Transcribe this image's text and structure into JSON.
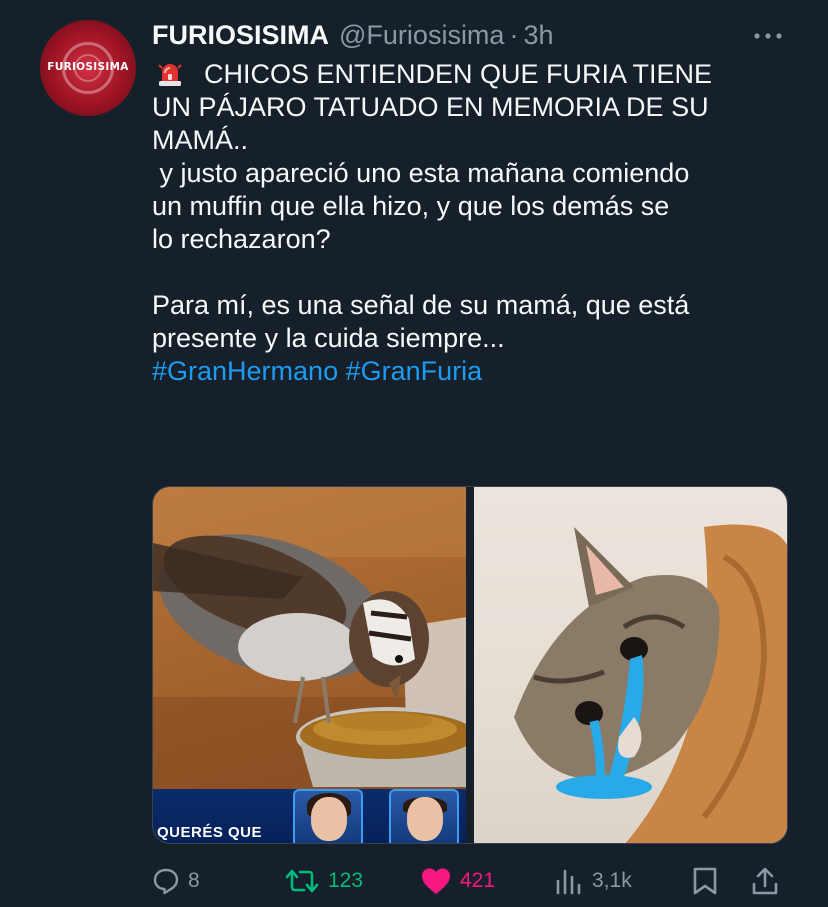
{
  "tweet": {
    "avatar_text": "FURIOSISIMA",
    "display_name": "FURIOSISIMA",
    "handle": "@Furiosisima",
    "separator": "·",
    "time": "3h",
    "text_lines": [
      "CHICOS ENTIENDEN QUE FURIA TIENE",
      "UN PÁJARO TATUADO EN MEMORIA DE SU",
      "MAMÁ..",
      " y justo apareció uno esta mañana comiendo",
      "un muffin que ella hizo, y que los demás se",
      "lo rechazaron?",
      "",
      "Para mí, es una señal de su mamá, que está",
      "presente y la cuida siempre..."
    ],
    "hashtags": "#GranHermano #GranFuria",
    "media": {
      "tv_caption": "QUERÉS QUE"
    },
    "actions": {
      "reply_count": "8",
      "retweet_count": "123",
      "like_count": "421",
      "views_count": "3,1k"
    }
  },
  "icons": {
    "siren": "police-car-light-icon",
    "more": "more-horizontal-icon",
    "reply": "reply-icon",
    "retweet": "retweet-icon",
    "like": "heart-filled-icon",
    "views": "views-icon",
    "bookmark": "bookmark-icon",
    "share": "share-icon"
  },
  "colors": {
    "background": "#15202b",
    "text": "#f7f9f9",
    "muted": "#8b98a5",
    "link": "#1d9bf0",
    "retweet": "#00ba7c",
    "like": "#f91880"
  }
}
